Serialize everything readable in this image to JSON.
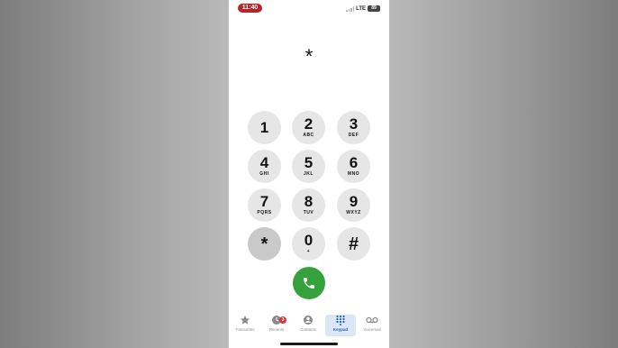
{
  "status_bar": {
    "time": "11:40",
    "network": "LTE",
    "battery": "89"
  },
  "display": {
    "number": "*"
  },
  "keypad": [
    {
      "digit": "1",
      "letters": ""
    },
    {
      "digit": "2",
      "letters": "ABC"
    },
    {
      "digit": "3",
      "letters": "DEF"
    },
    {
      "digit": "4",
      "letters": "GHI"
    },
    {
      "digit": "5",
      "letters": "JKL"
    },
    {
      "digit": "6",
      "letters": "MNO"
    },
    {
      "digit": "7",
      "letters": "PQRS"
    },
    {
      "digit": "8",
      "letters": "TUV"
    },
    {
      "digit": "9",
      "letters": "WXYZ"
    },
    {
      "digit": "*",
      "letters": ""
    },
    {
      "digit": "0",
      "letters": "+"
    },
    {
      "digit": "#",
      "letters": ""
    }
  ],
  "call_button": {
    "icon": "phone-icon",
    "color": "#34a13a"
  },
  "tabs": [
    {
      "label": "Favourites",
      "icon": "star-icon"
    },
    {
      "label": "Recents",
      "icon": "clock-icon",
      "badge": "3"
    },
    {
      "label": "Contacts",
      "icon": "person-icon"
    },
    {
      "label": "Keypad",
      "icon": "keypad-icon",
      "active": true
    },
    {
      "label": "Voicemail",
      "icon": "voicemail-icon"
    }
  ],
  "colors": {
    "accent": "#1a5fbf",
    "badge": "#d63a3a",
    "time_pill": "#b3262b"
  }
}
